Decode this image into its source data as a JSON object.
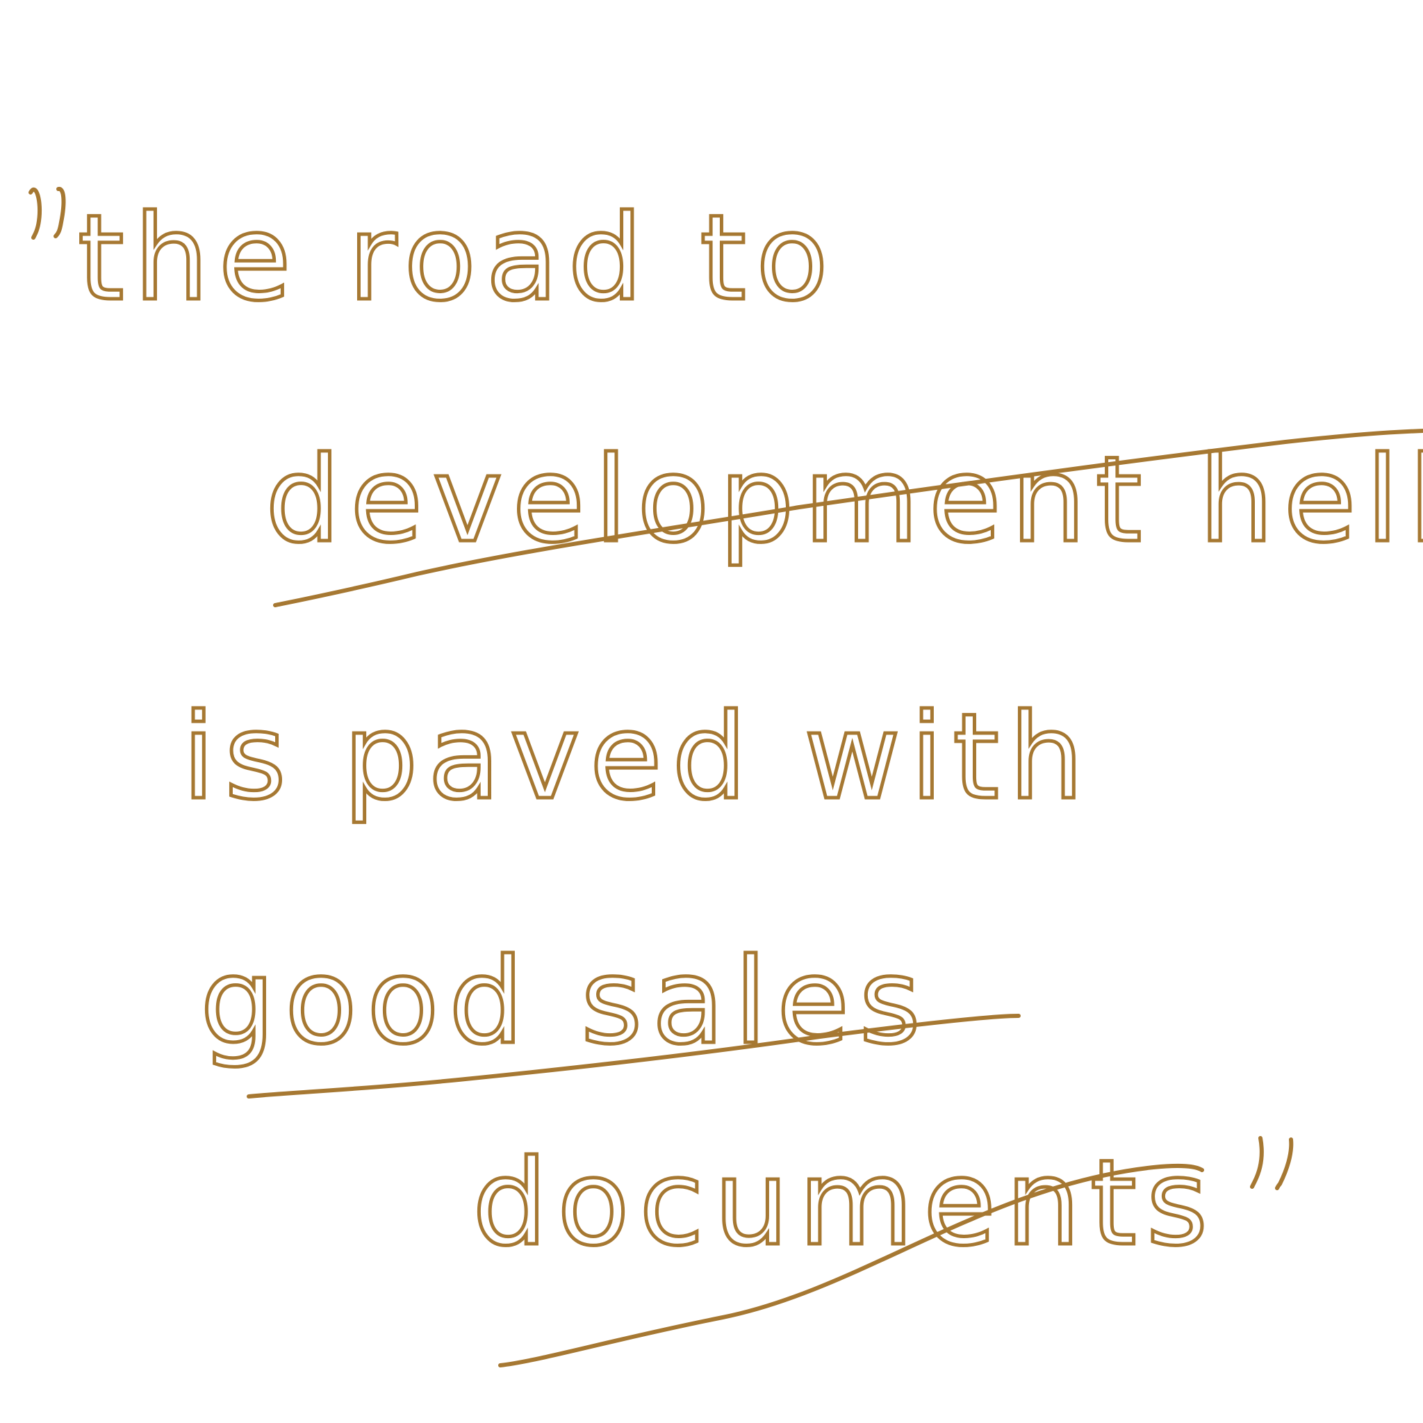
{
  "quote": {
    "open_mark": "\"",
    "line1": "the road to",
    "line2": "development hell",
    "line3": "is paved with",
    "line4": "good sales",
    "line5": "documents",
    "close_mark": "\""
  },
  "ink_color": "#a67832",
  "background": "#ffffff"
}
